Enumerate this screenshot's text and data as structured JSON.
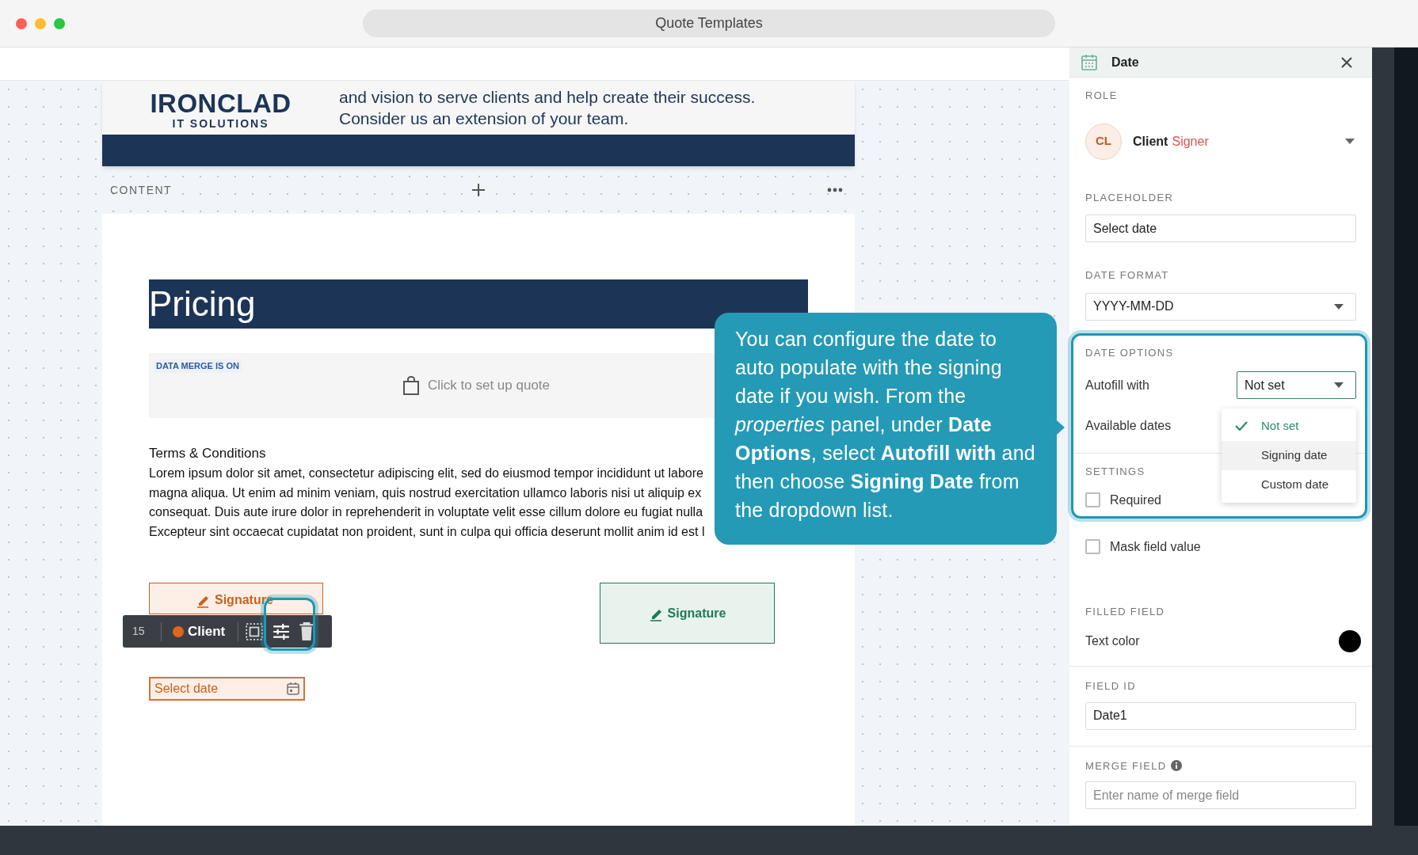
{
  "window": {
    "title": "Quote Templates"
  },
  "document": {
    "header": {
      "logo_title": "IRONCLAD",
      "logo_subtitle": "IT SOLUTIONS",
      "tagline_lines": [
        "and vision to serve clients and help create their success.",
        "Consider us an extension of your team."
      ]
    },
    "section_label": "CONTENT",
    "heading": "Pricing",
    "quote_block": {
      "badge": "DATA MERGE IS ON",
      "action": "Click to set up quote"
    },
    "terms": {
      "title": "Terms & Conditions",
      "lines": [
        "Lorem ipsum dolor sit amet, consectetur adipiscing elit, sed do eiusmod tempor incididunt ut labore",
        "magna aliqua. Ut enim ad minim veniam, quis nostrud exercitation ullamco laboris nisi ut aliquip ex",
        "consequat. Duis aute irure dolor in reprehenderit in voluptate velit esse cillum dolore eu fugiat nulla",
        "Excepteur sint occaecat cupidatat non proident, sunt in culpa qui officia deserunt mollit anim id est l"
      ]
    },
    "signature_fields": [
      {
        "label": "Signature",
        "color": "#c9611f"
      },
      {
        "label": "Signature",
        "color": "#1f7a55"
      }
    ],
    "field_toolbar": {
      "number": "15",
      "role": "Client",
      "color": "#e0661c"
    },
    "date_field": {
      "placeholder": "Select date"
    }
  },
  "tooltip": {
    "text": "You can configure the date to auto populate with the signing date if you wish. From the *properties* panel, under **Date Options**, select **Autofill with** and then choose **Signing Date** from the dropdown list."
  },
  "panel": {
    "title": "Date",
    "role": {
      "label": "ROLE",
      "initials": "CL",
      "name": "Client",
      "type": "Signer"
    },
    "placeholder_field": {
      "label": "PLACEHOLDER",
      "value": "Select date"
    },
    "date_format": {
      "label": "DATE FORMAT",
      "value": "YYYY-MM-DD"
    },
    "date_options": {
      "label": "DATE OPTIONS",
      "autofill_label": "Autofill with",
      "autofill_value": "Not set",
      "available_label": "Available dates",
      "menu": [
        {
          "label": "Not set",
          "selected": true,
          "highlighted": false
        },
        {
          "label": "Signing date",
          "selected": false,
          "highlighted": true
        },
        {
          "label": "Custom date",
          "selected": false,
          "highlighted": false
        }
      ]
    },
    "settings": {
      "label": "SETTINGS",
      "checkboxes": [
        {
          "label": "Required",
          "checked": false
        },
        {
          "label": "Mask field value",
          "checked": false
        }
      ]
    },
    "filled_field": {
      "label": "FILLED FIELD",
      "text_color_label": "Text color",
      "color": "#000000"
    },
    "field_id": {
      "label": "FIELD ID",
      "value": "Date1"
    },
    "merge_field": {
      "label": "MERGE FIELD",
      "placeholder": "Enter name of merge field"
    }
  }
}
